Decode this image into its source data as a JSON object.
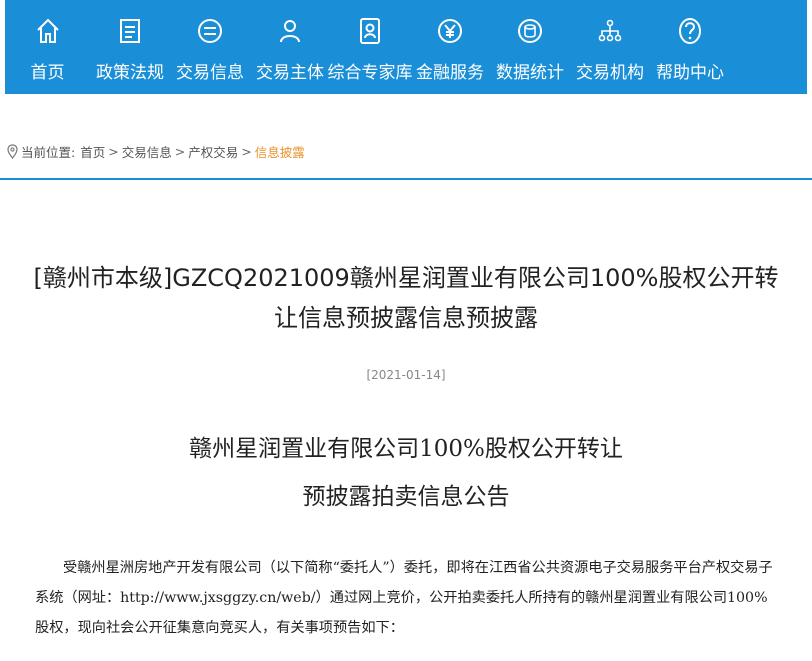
{
  "nav": {
    "items": [
      {
        "label": "首页",
        "icon": "home-icon"
      },
      {
        "label": "政策法规",
        "icon": "document-icon"
      },
      {
        "label": "交易信息",
        "icon": "exchange-icon"
      },
      {
        "label": "交易主体",
        "icon": "user-icon"
      },
      {
        "label": "综合专家库",
        "icon": "expert-icon"
      },
      {
        "label": "金融服务",
        "icon": "finance-icon"
      },
      {
        "label": "数据统计",
        "icon": "database-icon"
      },
      {
        "label": "交易机构",
        "icon": "org-icon"
      },
      {
        "label": "帮助中心",
        "icon": "help-icon"
      }
    ],
    "bg_color": "#1a8fd8"
  },
  "breadcrumb": {
    "prefix": "当前位置:",
    "items": [
      "首页",
      "交易信息",
      "产权交易"
    ],
    "current": "信息披露",
    "separator": ">"
  },
  "article": {
    "title": "[赣州市本级]GZCQ2021009赣州星润置业有限公司100%股权公开转让信息预披露信息预披露",
    "date": "[2021-01-14]",
    "heading_line1": "赣州星润置业有限公司100%股权公开转让",
    "heading_line2": "预披露拍卖信息公告",
    "paragraph": "受赣州星洲房地产开发有限公司（以下简称“委托人”）委托，即将在江西省公共资源电子交易服务平台产权交易子系统（网址：http://www.jxsggzy.cn/web/）通过网上竞价，公开拍卖委托人所持有的赣州星润置业有限公司100%股权，现向社会公开征集意向竞买人，有关事项预告如下："
  }
}
